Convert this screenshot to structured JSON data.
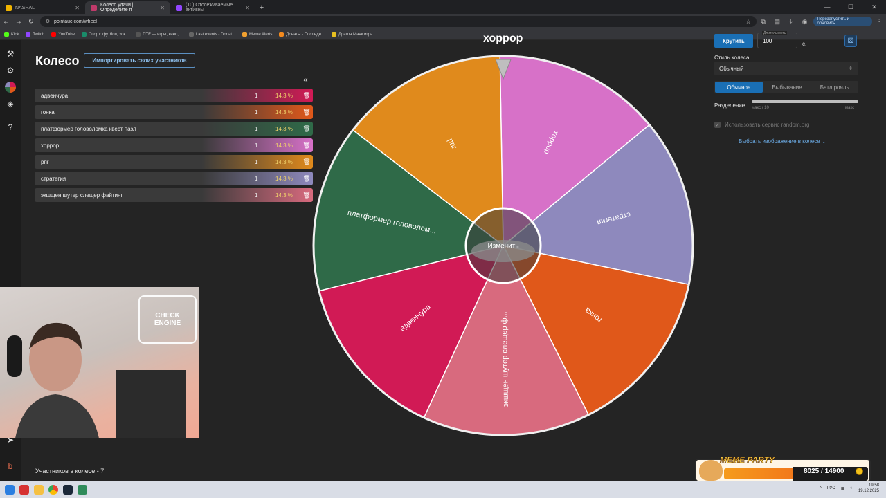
{
  "browser": {
    "tabs": [
      {
        "label": "NASRAL",
        "color": "#f0b400"
      },
      {
        "label": "Колесо удачи | Определите п",
        "color": "#c03a6a"
      },
      {
        "label": "(10) Отслеживаемые активны",
        "color": "#9146ff"
      }
    ],
    "url": "pointauc.com/wheel",
    "relaunch": "Перезапустить и обновить",
    "bookmarks": [
      {
        "label": "Kick",
        "color": "#53fc18"
      },
      {
        "label": "Twitch",
        "color": "#9146ff"
      },
      {
        "label": "YouTube",
        "color": "#ff0000"
      },
      {
        "label": "Спорт: футбол, хок...",
        "color": "#2f2f2f"
      },
      {
        "label": "DTF — игры, кино,...",
        "color": "#222"
      },
      {
        "label": "Last events - Donat...",
        "color": "#333"
      },
      {
        "label": "Meme Alerts",
        "color": "#f0a030"
      },
      {
        "label": "Донаты - Последн...",
        "color": "#f38a1e"
      },
      {
        "label": "Драгон Манк игра...",
        "color": "#e8c020"
      }
    ]
  },
  "page": {
    "title": "Колесо",
    "import_label": "Импортировать своих участников",
    "collapse": "«",
    "footer": "Участников в колесе - 7"
  },
  "participants": [
    {
      "name": "адвенчура",
      "count": "1",
      "percent": "14.3 %",
      "color": "#d11a55"
    },
    {
      "name": "гонка",
      "count": "1",
      "percent": "14.3 %",
      "color": "#e0581a"
    },
    {
      "name": "платформер головоломка квест пазл",
      "count": "1",
      "percent": "14.3 %",
      "color": "#2f6a48"
    },
    {
      "name": "хоррор",
      "count": "1",
      "percent": "14.3 %",
      "color": "#d771c8"
    },
    {
      "name": "рпг",
      "count": "1",
      "percent": "14.3 %",
      "color": "#e08a1c"
    },
    {
      "name": "стратегия",
      "count": "1",
      "percent": "14.3 %",
      "color": "#8e89bd"
    },
    {
      "name": "экшщен шутер слещер файтинг",
      "count": "1",
      "percent": "14.3 %",
      "color": "#d86a7e"
    }
  ],
  "wheel": {
    "current": "хоррор",
    "center_label": "Изменить",
    "slices": [
      {
        "label": "хоррор",
        "color": "#d771c8"
      },
      {
        "label": "стратегия",
        "color": "#8e89bd"
      },
      {
        "label": "гонка",
        "color": "#e0581a"
      },
      {
        "label": "экшщен шутер слещер ф...",
        "color": "#d86a7e"
      },
      {
        "label": "адвенчура",
        "color": "#d11a55"
      },
      {
        "label": "платформер головолом...",
        "color": "#2f6a48"
      },
      {
        "label": "рпг",
        "color": "#e08a1c"
      }
    ]
  },
  "controls": {
    "spin": "Крутить",
    "duration_label": "Длительность",
    "duration_value": "100",
    "duration_unit": "с.",
    "style_label": "Стиль колеса",
    "style_value": "Обычный",
    "modes": [
      "Обычное",
      "Выбывание",
      "Батл рояль"
    ],
    "split_label": "Разделение",
    "split_min": "макс / 10",
    "split_max": "макс",
    "random_org": "Использовать сервис random.org",
    "image_link": "Выбрать изображение в колесе"
  },
  "overlay": {
    "meme_title": "MEME PARTY",
    "meme_score": "8025 / 14900",
    "meme_progress": 0.539
  },
  "taskbar": {
    "lang": "РУС",
    "time": "19:58",
    "date": "19.12.2025"
  }
}
